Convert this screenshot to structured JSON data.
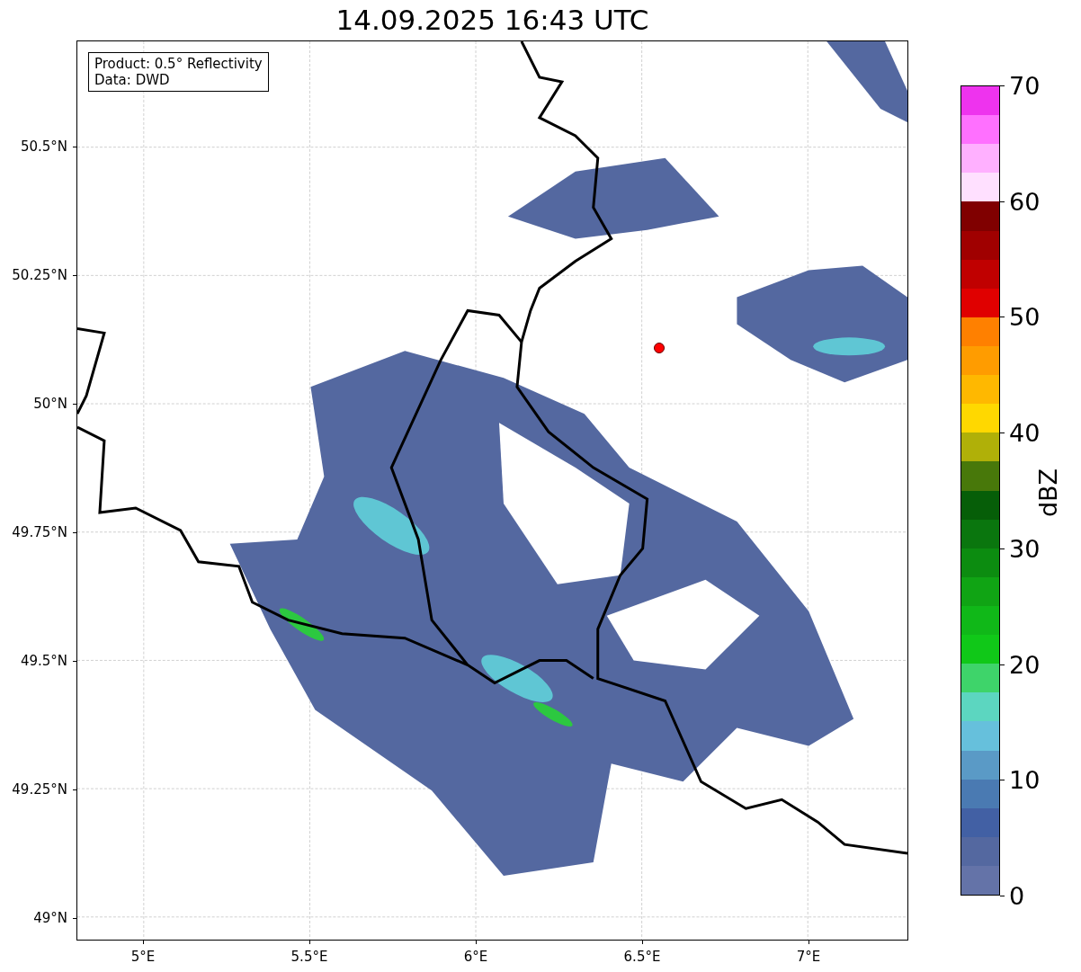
{
  "title": "14.09.2025 16:43 UTC",
  "map": {
    "info_lines": [
      "Product: 0.5° Reflectivity",
      "Data: DWD"
    ],
    "yticks": [
      "50.5°N",
      "50.25°N",
      "50°N",
      "49.75°N",
      "49.5°N",
      "49.25°N",
      "49°N"
    ],
    "xticks": [
      "5°E",
      "5.5°E",
      "6°E",
      "6.5°E",
      "7°E"
    ]
  },
  "colorbar": {
    "label": "dBZ",
    "ticks": [
      "70",
      "60",
      "50",
      "40",
      "30",
      "20",
      "10",
      "0"
    ],
    "bins": [
      {
        "color": "#ee33ee"
      },
      {
        "color": "#ff70ff"
      },
      {
        "color": "#ffb0ff"
      },
      {
        "color": "#ffe0ff"
      },
      {
        "color": "#800000"
      },
      {
        "color": "#a00000"
      },
      {
        "color": "#c00000"
      },
      {
        "color": "#e00000"
      },
      {
        "color": "#ff8000"
      },
      {
        "color": "#ff9c00"
      },
      {
        "color": "#ffb800"
      },
      {
        "color": "#ffd800"
      },
      {
        "color": "#b0b008"
      },
      {
        "color": "#48780a"
      },
      {
        "color": "#065e08"
      },
      {
        "color": "#0a760e"
      },
      {
        "color": "#0c8c10"
      },
      {
        "color": "#10a414"
      },
      {
        "color": "#10b818"
      },
      {
        "color": "#10c818"
      },
      {
        "color": "#3ed46a"
      },
      {
        "color": "#5cd6c0"
      },
      {
        "color": "#66c0dc"
      },
      {
        "color": "#5a9ac6"
      },
      {
        "color": "#4a7ab2"
      },
      {
        "color": "#4260a4"
      },
      {
        "color": "#5468a0"
      },
      {
        "color": "#6473a8"
      }
    ]
  }
}
